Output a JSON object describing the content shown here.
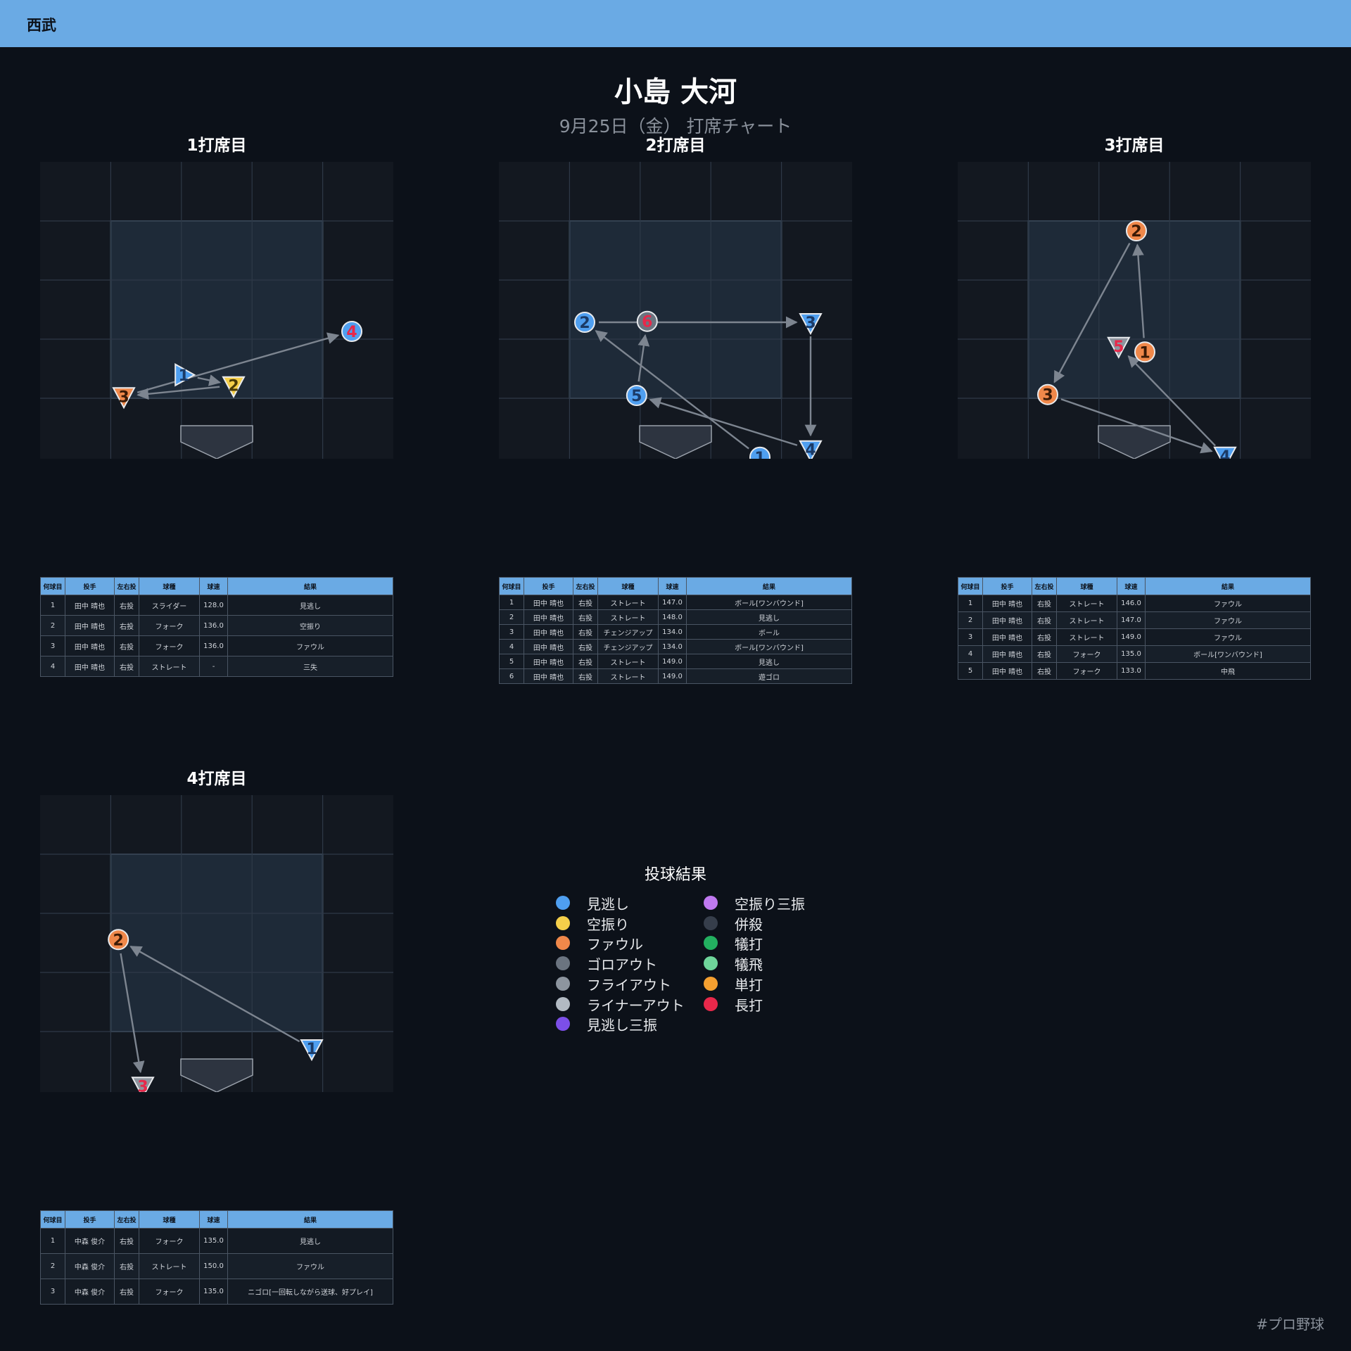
{
  "header": {
    "team": "西武"
  },
  "player": {
    "name": "小島 大河",
    "subtitle": "9月25日（金） 打席チャート"
  },
  "colors": {
    "header_bg": "#6aaae4",
    "page_bg": "#0c1119",
    "zone_bg": "#1e2a38",
    "outer_bg": "#131820",
    "arrow": "#7d8590"
  },
  "table_headers": [
    "何球目",
    "投手",
    "左右投",
    "球種",
    "球速",
    "結果"
  ],
  "legend": {
    "title": "投球結果",
    "items": [
      {
        "label": "見逃し",
        "color": "#4f9ff0"
      },
      {
        "label": "空振り",
        "color": "#f5cf4a"
      },
      {
        "label": "ファウル",
        "color": "#f0884a"
      },
      {
        "label": "ゴロアウト",
        "color": "#6b7480"
      },
      {
        "label": "フライアウト",
        "color": "#8d959f"
      },
      {
        "label": "ライナーアウト",
        "color": "#b2bac3"
      },
      {
        "label": "見逃し三振",
        "color": "#7c4fe8"
      },
      {
        "label": "空振り三振",
        "color": "#c079f0"
      },
      {
        "label": "併殺",
        "color": "#363e4b"
      },
      {
        "label": "犠打",
        "color": "#23b060"
      },
      {
        "label": "犠飛",
        "color": "#6fd69b"
      },
      {
        "label": "単打",
        "color": "#f5a030"
      },
      {
        "label": "長打",
        "color": "#e8284a"
      }
    ]
  },
  "hashtag": "#プロ野球",
  "chart_data": [
    {
      "type": "scatter",
      "title": "1打席目",
      "pitches": [
        {
          "n": 1,
          "pitcher": "田中 晴也",
          "hand": "右投",
          "pitch": "スライダー",
          "speed": "128.0",
          "result": "見逃し",
          "x": -0.78,
          "y": 0.05,
          "marker": "triangle-right",
          "color": "#4f9ff0",
          "num_color": "#1b3a66"
        },
        {
          "n": 2,
          "pitcher": "田中 晴也",
          "hand": "右投",
          "pitch": "フォーク",
          "speed": "136.0",
          "result": "空振り",
          "x": 0.4,
          "y": -0.18,
          "marker": "triangle-down",
          "color": "#f5cf4a",
          "num_color": "#4a3a06"
        },
        {
          "n": 3,
          "pitcher": "田中 晴也",
          "hand": "右投",
          "pitch": "フォーク",
          "speed": "136.0",
          "result": "ファウル",
          "x": -2.2,
          "y": -0.42,
          "marker": "triangle-down",
          "color": "#f0884a",
          "num_color": "#3a1a06"
        },
        {
          "n": 4,
          "pitcher": "田中 晴也",
          "hand": "右投",
          "pitch": "ストレート",
          "speed": "-",
          "result": "三失",
          "x": 3.2,
          "y": 1.0,
          "marker": "circle",
          "color": "#4f9ff0",
          "num_color": "#e8284a"
        }
      ]
    },
    {
      "type": "scatter",
      "title": "2打席目",
      "pitches": [
        {
          "n": 1,
          "pitcher": "田中 晴也",
          "hand": "右投",
          "pitch": "ストレート",
          "speed": "147.0",
          "result": "ボール[ワンバウンド]",
          "x": 2.0,
          "y": -1.75,
          "marker": "circle",
          "color": "#4f9ff0",
          "num_color": "#1b3a66"
        },
        {
          "n": 2,
          "pitcher": "田中 晴也",
          "hand": "右投",
          "pitch": "ストレート",
          "speed": "148.0",
          "result": "見逃し",
          "x": -2.15,
          "y": 1.2,
          "marker": "circle",
          "color": "#4f9ff0",
          "num_color": "#1b3a66"
        },
        {
          "n": 3,
          "pitcher": "田中 晴也",
          "hand": "右投",
          "pitch": "チェンジアップ",
          "speed": "134.0",
          "result": "ボール",
          "x": 3.2,
          "y": 1.2,
          "marker": "triangle-down",
          "color": "#4f9ff0",
          "num_color": "#1b3a66"
        },
        {
          "n": 4,
          "pitcher": "田中 晴也",
          "hand": "右投",
          "pitch": "チェンジアップ",
          "speed": "134.0",
          "result": "ボール[ワンバウンド]",
          "x": 3.2,
          "y": -1.58,
          "marker": "triangle-down",
          "color": "#4f9ff0",
          "num_color": "#1b3a66"
        },
        {
          "n": 5,
          "pitcher": "田中 晴也",
          "hand": "右投",
          "pitch": "ストレート",
          "speed": "149.0",
          "result": "見逃し",
          "x": -0.92,
          "y": -0.4,
          "marker": "circle",
          "color": "#4f9ff0",
          "num_color": "#1b3a66"
        },
        {
          "n": 6,
          "pitcher": "田中 晴也",
          "hand": "右投",
          "pitch": "ストレート",
          "speed": "149.0",
          "result": "遊ゴロ",
          "x": -0.67,
          "y": 1.22,
          "marker": "circle",
          "color": "#6b7480",
          "num_color": "#e8284a"
        }
      ]
    },
    {
      "type": "scatter",
      "title": "3打席目",
      "pitches": [
        {
          "n": 1,
          "pitcher": "田中 晴也",
          "hand": "右投",
          "pitch": "ストレート",
          "speed": "146.0",
          "result": "ファウル",
          "x": 0.25,
          "y": 0.55,
          "marker": "circle",
          "color": "#f0884a",
          "num_color": "#3a1a06"
        },
        {
          "n": 2,
          "pitcher": "田中 晴也",
          "hand": "右投",
          "pitch": "ストレート",
          "speed": "147.0",
          "result": "ファウル",
          "x": 0.05,
          "y": 3.2,
          "marker": "circle",
          "color": "#f0884a",
          "num_color": "#3a1a06"
        },
        {
          "n": 3,
          "pitcher": "田中 晴也",
          "hand": "右投",
          "pitch": "ストレート",
          "speed": "149.0",
          "result": "ファウル",
          "x": -2.05,
          "y": -0.38,
          "marker": "circle",
          "color": "#f0884a",
          "num_color": "#3a1a06"
        },
        {
          "n": 4,
          "pitcher": "田中 晴也",
          "hand": "右投",
          "pitch": "フォーク",
          "speed": "135.0",
          "result": "ボール[ワンバウンド]",
          "x": 2.15,
          "y": -1.72,
          "marker": "triangle-down",
          "color": "#4f9ff0",
          "num_color": "#1b3a66"
        },
        {
          "n": 5,
          "pitcher": "田中 晴也",
          "hand": "右投",
          "pitch": "フォーク",
          "speed": "133.0",
          "result": "中飛",
          "x": -0.37,
          "y": 0.68,
          "marker": "triangle-down",
          "color": "#8d959f",
          "num_color": "#e8284a"
        }
      ]
    },
    {
      "type": "scatter",
      "title": "4打席目",
      "pitches": [
        {
          "n": 1,
          "pitcher": "中森 俊介",
          "hand": "右投",
          "pitch": "フォーク",
          "speed": "135.0",
          "result": "見逃し",
          "x": 2.25,
          "y": -0.83,
          "marker": "triangle-down",
          "color": "#4f9ff0",
          "num_color": "#1b3a66"
        },
        {
          "n": 2,
          "pitcher": "中森 俊介",
          "hand": "右投",
          "pitch": "ストレート",
          "speed": "150.0",
          "result": "ファウル",
          "x": -2.33,
          "y": 1.55,
          "marker": "circle",
          "color": "#f0884a",
          "num_color": "#3a1a06"
        },
        {
          "n": 3,
          "pitcher": "中森 俊介",
          "hand": "右投",
          "pitch": "フォーク",
          "speed": "135.0",
          "result": "ニゴロ[一回転しながら送球、好プレイ]",
          "x": -1.75,
          "y": -1.65,
          "marker": "triangle-down",
          "color": "#8d959f",
          "num_color": "#e8284a"
        }
      ]
    }
  ]
}
